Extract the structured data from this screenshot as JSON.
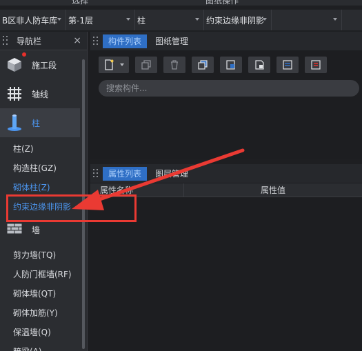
{
  "top_strip": {
    "left_text": "选择",
    "center_text": "图纸操作"
  },
  "selectors": [
    {
      "value": "B区非人防车库"
    },
    {
      "value": "第-1层"
    },
    {
      "value": "柱"
    },
    {
      "value": "约束边缘非阴影"
    },
    {
      "value": ""
    }
  ],
  "nav": {
    "title": "导航栏",
    "close_label": "×",
    "categories": [
      {
        "label": "施工段",
        "icon": "construction-segment-icon"
      },
      {
        "label": "轴线",
        "icon": "grid-axis-icon"
      },
      {
        "label": "柱",
        "icon": "column-icon"
      },
      {
        "label": "墙",
        "icon": "wall-icon"
      }
    ],
    "column_items": [
      "柱(Z)",
      "构造柱(GZ)",
      "砌体柱(Z)",
      "约束边缘非阴影"
    ],
    "wall_items": [
      "剪力墙(TQ)",
      "人防门框墙(RF)",
      "砌体墙(QT)",
      "砌体加筋(Y)",
      "保温墙(Q)",
      "暗梁(A)"
    ]
  },
  "component_panel": {
    "tabs": [
      "构件列表",
      "图纸管理"
    ],
    "toolbar": [
      "new-icon",
      "copy-icon",
      "delete-icon",
      "copy-to-floor-icon",
      "copy-from-floor-icon",
      "save-component-icon",
      "list-icon",
      "properties-icon"
    ],
    "search_placeholder": "搜索构件..."
  },
  "property_panel": {
    "tabs": [
      "属性列表",
      "图层管理"
    ],
    "columns": [
      "属性名称",
      "属性值"
    ]
  },
  "colors": {
    "accent": "#2f6fc5",
    "accent_text": "#4c96f0",
    "annotation": "#ea3a33",
    "badge": "#e8302b"
  }
}
